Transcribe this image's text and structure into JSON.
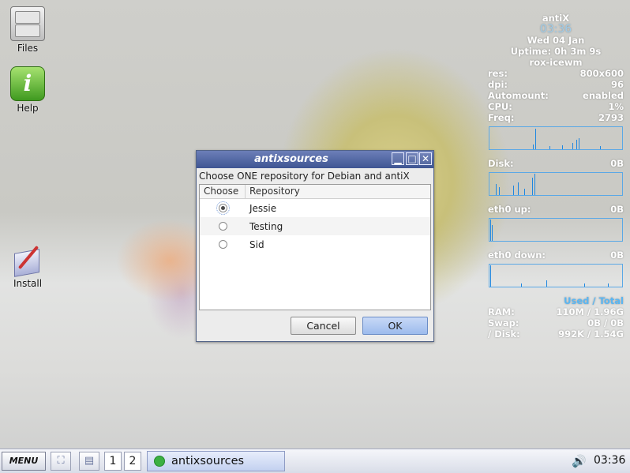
{
  "desktop": {
    "icons": [
      {
        "label": "Files",
        "icon": "file-cabinet-icon"
      },
      {
        "label": "Help",
        "icon": "info-icon"
      },
      {
        "label": "Install",
        "icon": "installer-icon"
      }
    ]
  },
  "conky": {
    "hostname": "antiX",
    "time": "03:36",
    "date": "Wed 04 Jan",
    "uptime": "Uptime: 0h 3m 9s",
    "wm": "rox-icewm",
    "stats": [
      {
        "label": "res:",
        "value": "800x600"
      },
      {
        "label": "dpi:",
        "value": "96"
      },
      {
        "label": "Automount:",
        "value": "enabled"
      },
      {
        "label": "CPU:",
        "value": "1%"
      },
      {
        "label": "Freq:",
        "value": "2793"
      }
    ],
    "disk": {
      "label": "Disk:",
      "value": "0B"
    },
    "eth_up": {
      "label": "eth0 up:",
      "value": "0B"
    },
    "eth_down": {
      "label": "eth0 down:",
      "value": "0B"
    },
    "used_total": "Used / Total",
    "mem": [
      {
        "label": "RAM:",
        "value": "110M / 1.96G"
      },
      {
        "label": "Swap:",
        "value": "0B / 0B"
      },
      {
        "label": "/ Disk:",
        "value": "992K / 1.54G"
      }
    ],
    "graph_color": "#1e86e0"
  },
  "dialog": {
    "title": "antixsources",
    "prompt": "Choose ONE repository for Debian and antiX",
    "columns": [
      "Choose",
      "Repository"
    ],
    "rows": [
      {
        "name": "Jessie",
        "selected": true
      },
      {
        "name": "Testing",
        "selected": false
      },
      {
        "name": "Sid",
        "selected": false
      }
    ],
    "cancel_label": "Cancel",
    "ok_label": "OK",
    "controls": {
      "minimize": "minimize-icon",
      "maximize": "maximize-icon",
      "close": "close-icon"
    }
  },
  "taskbar": {
    "menu_label": "MENU",
    "workspaces": [
      "1",
      "2"
    ],
    "task_label": "antixsources",
    "clock": "03:36",
    "speaker_icon": "🔊"
  }
}
